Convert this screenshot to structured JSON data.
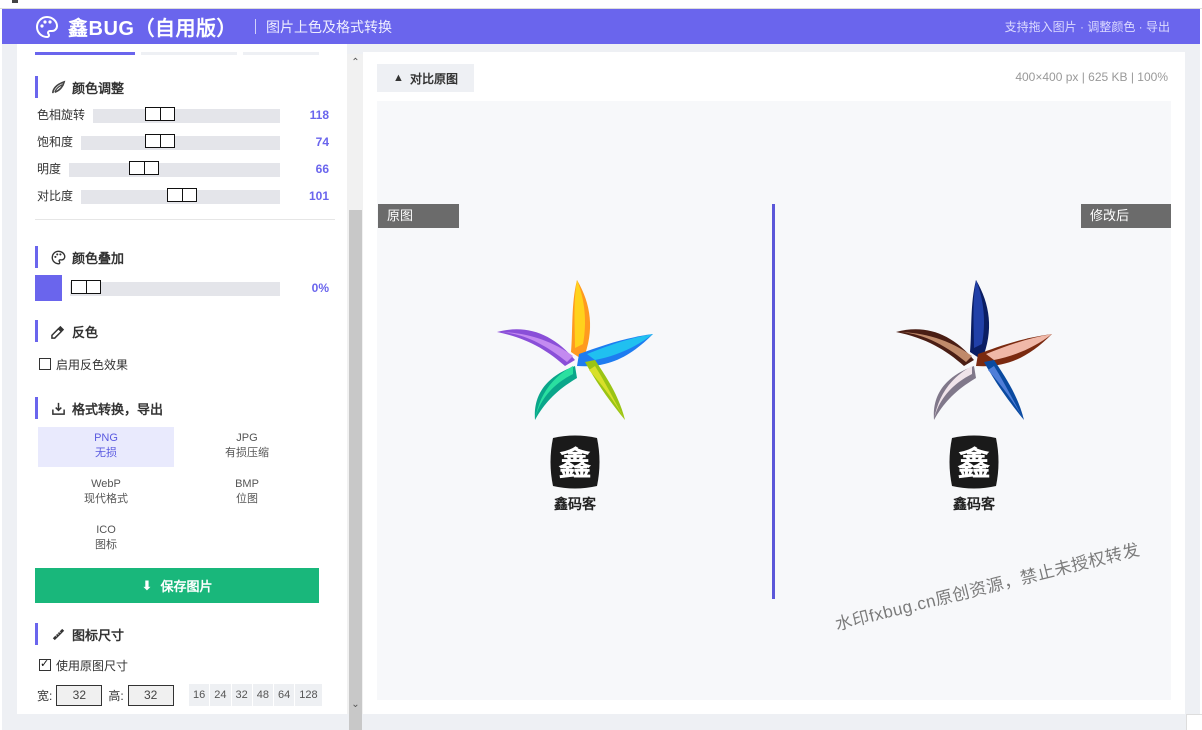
{
  "header": {
    "brand": "鑫BUG（自用版）",
    "subtitle": "图片上色及格式转换",
    "hint": "支持拖入图片 · 调整颜色 · 导出"
  },
  "colors": {
    "accent": "#6a65ed",
    "save": "#19b77b",
    "overlay_swatch": "#6a65ed"
  },
  "color_adjust": {
    "title": "颜色调整",
    "sliders": [
      {
        "label": "色相旋转",
        "value": "118"
      },
      {
        "label": "饱和度",
        "value": "74"
      },
      {
        "label": "明度",
        "value": "66"
      },
      {
        "label": "对比度",
        "value": "101"
      }
    ]
  },
  "color_overlay": {
    "title": "颜色叠加",
    "value": "0%"
  },
  "invert": {
    "title": "反色",
    "checkbox_label": "启用反色效果",
    "checked": false
  },
  "format": {
    "title": "格式转换，导出",
    "options": [
      {
        "name": "PNG",
        "desc": "无损",
        "selected": true
      },
      {
        "name": "JPG",
        "desc": "有损压缩",
        "selected": false
      },
      {
        "name": "WebP",
        "desc": "现代格式",
        "selected": false
      },
      {
        "name": "BMP",
        "desc": "位图",
        "selected": false
      },
      {
        "name": "ICO",
        "desc": "图标",
        "selected": false
      }
    ],
    "save_label": "保存图片"
  },
  "icon_size": {
    "title": "图标尺寸",
    "checkbox_label": "使用原图尺寸",
    "checked": true,
    "width_label": "宽:",
    "width_value": "32",
    "height_label": "高:",
    "height_value": "32",
    "presets": [
      "16",
      "24",
      "32",
      "48",
      "64",
      "128"
    ]
  },
  "preview": {
    "compare_label": "对比原图",
    "meta": "400×400 px | 625 KB | 100%",
    "original_tag": "原图",
    "modified_tag": "修改后",
    "seal_label": "鑫码客",
    "seal_char": "鑫",
    "watermark": "水印fxbug.cn原创资源，禁止未授权转发"
  }
}
